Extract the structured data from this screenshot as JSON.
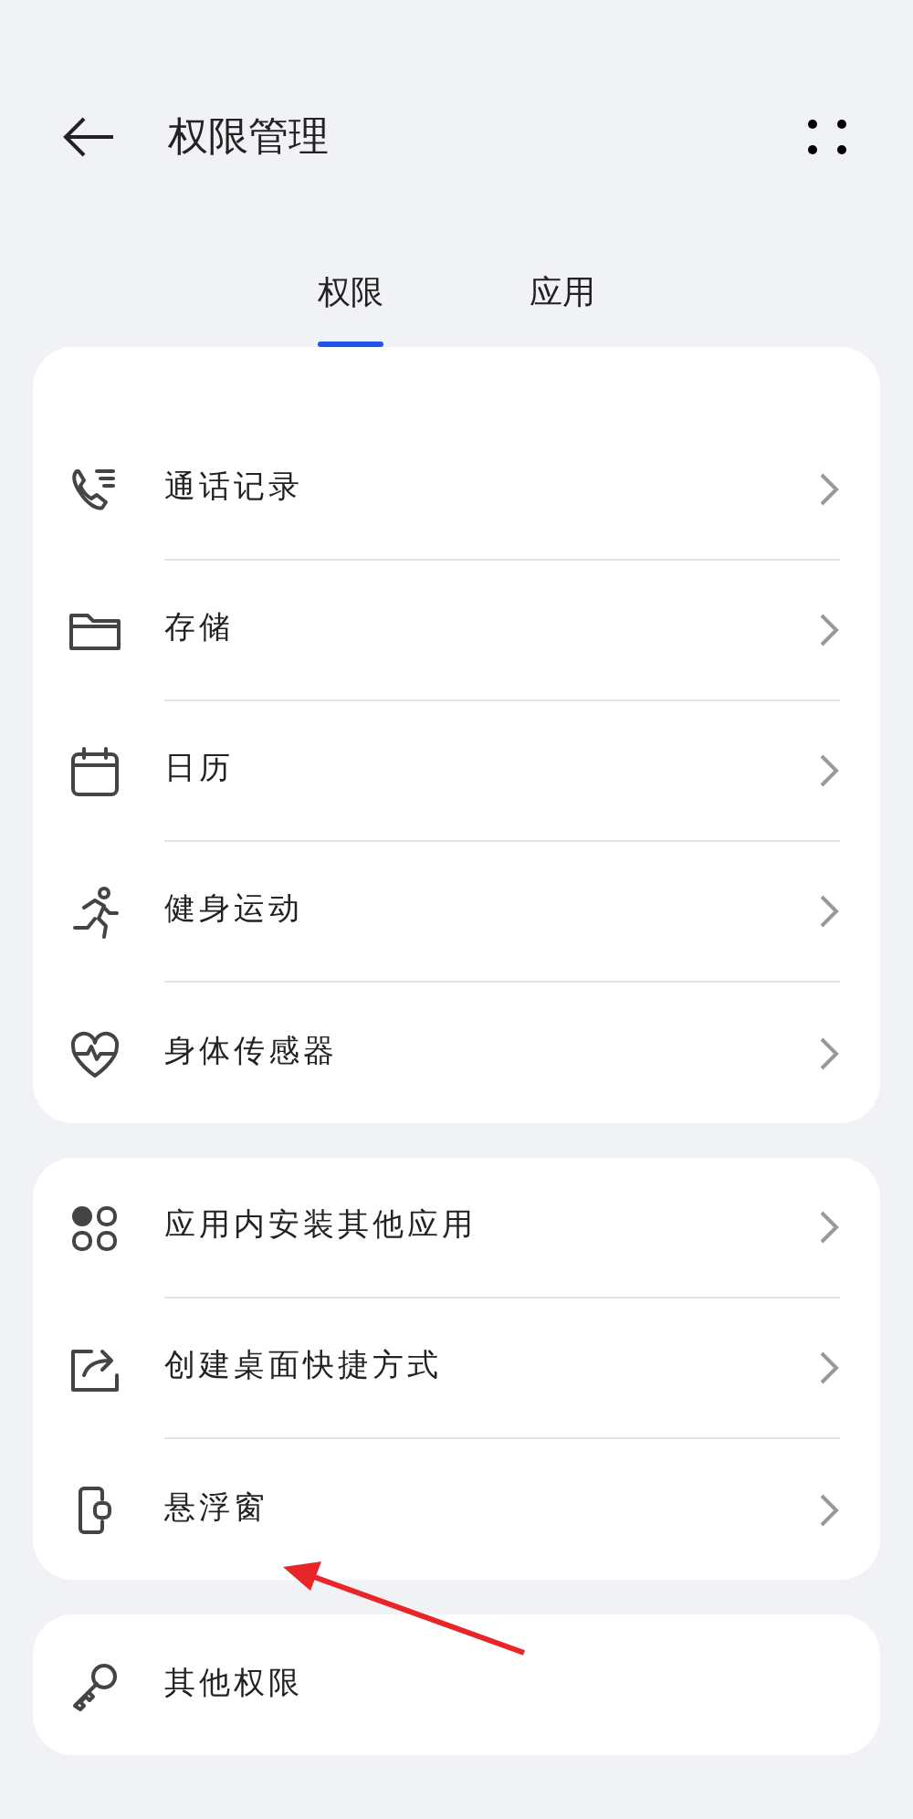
{
  "header": {
    "title": "权限管理"
  },
  "tabs": [
    {
      "label": "权限",
      "selected": true
    },
    {
      "label": "应用",
      "selected": false
    }
  ],
  "groups": [
    {
      "items": [
        {
          "label": "通话记录",
          "chevron": true
        },
        {
          "label": "存储",
          "chevron": true
        },
        {
          "label": "日历",
          "chevron": true
        },
        {
          "label": "健身运动",
          "chevron": true
        },
        {
          "label": "身体传感器",
          "chevron": true
        }
      ]
    },
    {
      "items": [
        {
          "label": "应用内安装其他应用",
          "chevron": true
        },
        {
          "label": "创建桌面快捷方式",
          "chevron": true
        },
        {
          "label": "悬浮窗",
          "chevron": true
        }
      ]
    },
    {
      "items": [
        {
          "label": "其他权限",
          "chevron": false
        }
      ]
    }
  ]
}
